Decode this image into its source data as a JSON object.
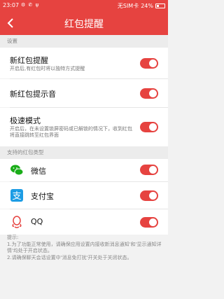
{
  "status_bar": {
    "time": "23:07",
    "left_icons": "⚙ ✆ ψ",
    "sim": "无SIM卡",
    "battery": "24%"
  },
  "nav": {
    "title": "红包提醒"
  },
  "settings_header": "设置",
  "settings": [
    {
      "label": "新红包提醒",
      "desc": "开启后,有红包时将以独特方式提醒",
      "on": true
    },
    {
      "label": "新红包提示音",
      "desc": "",
      "on": true
    },
    {
      "label": "极速模式",
      "desc": "开启后，在未设置锁屏密码或已解锁的情况下，收到红包将直接跳转至红包界面",
      "on": true
    }
  ],
  "apps_header": "支持的红包类型",
  "apps": [
    {
      "label": "微信",
      "icon": "wechat-icon",
      "color": "#1aad19",
      "on": true
    },
    {
      "label": "支付宝",
      "icon": "alipay-icon",
      "color": "#1c9ce4",
      "on": true
    },
    {
      "label": "QQ",
      "icon": "qq-icon",
      "color": "#e64340",
      "on": true
    }
  ],
  "tips": {
    "title": "提示:",
    "line1": "1.为了功能正常使用，请确保应用设置内接收新消息通知'和'显示通知详情'均处于开启状态。",
    "line2": "2.请确保聊天会话设置中'消息免打扰'开关处于关闭状态。"
  },
  "colors": {
    "accent": "#e64340"
  }
}
